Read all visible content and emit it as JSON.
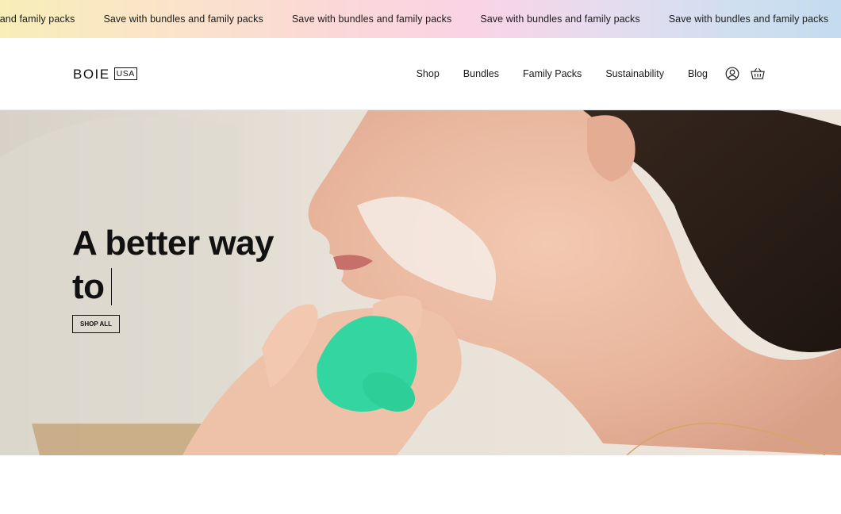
{
  "announcement": {
    "items": [
      "Save with bundles and family packs",
      "Save with bundles and family packs",
      "Save with bundles and family packs",
      "Save with bundles and family packs",
      "Save with bundles and family packs"
    ]
  },
  "header": {
    "logo": {
      "word": "BOIE",
      "badge": "USA"
    },
    "nav": [
      {
        "label": "Shop"
      },
      {
        "label": "Bundles"
      },
      {
        "label": "Family Packs"
      },
      {
        "label": "Sustainability"
      },
      {
        "label": "Blog"
      }
    ],
    "icons": {
      "account": "user-icon",
      "cart": "basket-icon"
    }
  },
  "hero": {
    "heading_line1": "A better way",
    "heading_line2": "to",
    "cta_label": "SHOP ALL",
    "image_subject": "woman-cleansing-face-photo",
    "accent_color": "#33d6a0"
  }
}
